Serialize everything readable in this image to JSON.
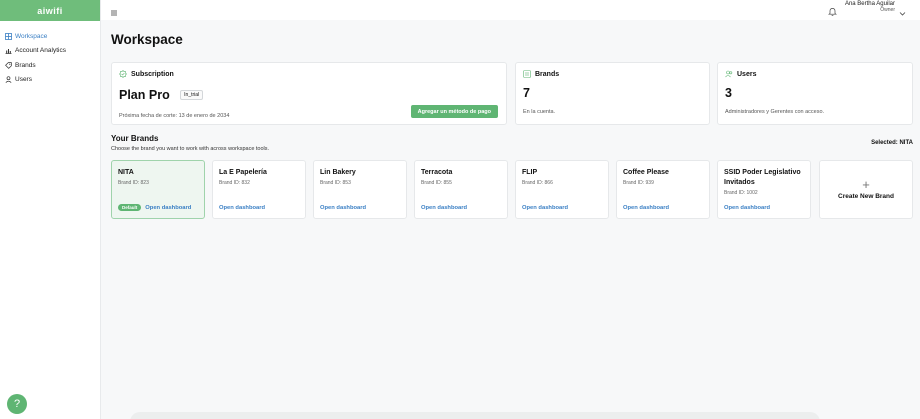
{
  "app": {
    "logo_text": "aiwifi",
    "accent": "#5fb573"
  },
  "sidebar": {
    "items": [
      {
        "label": "Workspace",
        "icon": "grid-icon",
        "active": true
      },
      {
        "label": "Account Analytics",
        "icon": "bar-chart-icon",
        "active": false
      },
      {
        "label": "Brands",
        "icon": "tags-icon",
        "active": false
      },
      {
        "label": "Users",
        "icon": "user-icon",
        "active": false
      }
    ],
    "help_label": "?"
  },
  "topbar": {
    "user_name": "Ana Bertha Aguilar",
    "user_role": "Owner"
  },
  "page": {
    "title": "Workspace"
  },
  "subscription": {
    "heading": "Subscription",
    "plan": "Plan Pro",
    "status_badge": "In_trial",
    "next_billing": "Próxima fecha de corte: 13 de enero de 2034",
    "pay_button": "Agregar un método de pago"
  },
  "brands_summary": {
    "heading": "Brands",
    "count": "7",
    "description": "En la cuenta."
  },
  "users_summary": {
    "heading": "Users",
    "count": "3",
    "description": "Administradores y Gerentes con acceso."
  },
  "your_brands": {
    "title": "Your Brands",
    "subtitle": "Choose the brand you want to work with across workspace tools.",
    "selected_label": "Selected: NITA",
    "default_badge": "Default",
    "open_label": "Open dashboard",
    "create_label": "Create New Brand",
    "create_icon": "+",
    "items": [
      {
        "name": "NITA",
        "id": "Brand ID: 823",
        "selected": true
      },
      {
        "name": "La E Papelería",
        "id": "Brand ID: 832"
      },
      {
        "name": "Lin Bakery",
        "id": "Brand ID: 853"
      },
      {
        "name": "Terracota",
        "id": "Brand ID: 855"
      },
      {
        "name": "FLIP",
        "id": "Brand ID: 866"
      },
      {
        "name": "Coffee Please",
        "id": "Brand ID: 939"
      },
      {
        "name": "SSID Poder Legislativo Invitados",
        "id": "Brand ID: 1002"
      }
    ]
  }
}
